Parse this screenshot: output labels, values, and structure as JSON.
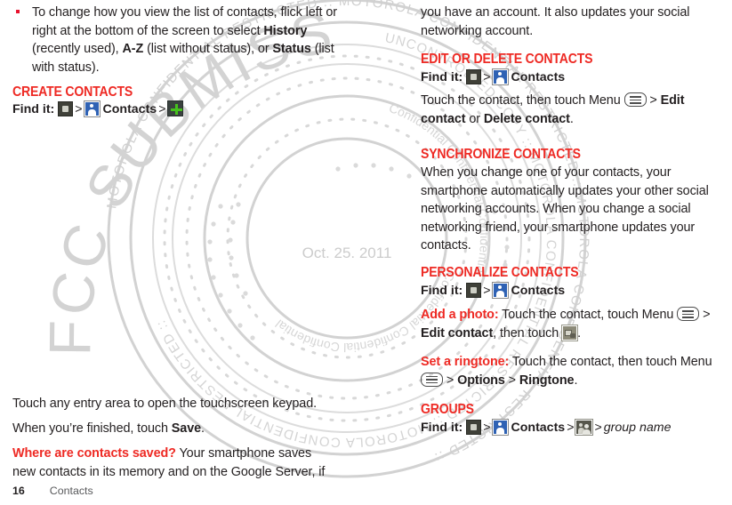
{
  "page": {
    "number": "16",
    "section": "Contacts"
  },
  "watermark": {
    "big_text": "FCC SUBMISSION",
    "ring_outer": "MOTOROLA CONFIDENTIAL RESTRICTED :: MOTOROLA CONFIDENTIAL RESTRICTED :: MOTOROLA CONFIDENTIAL RESTRICTED :: ",
    "ring_inner": "UNCONTROLLED COPY :: MOTOROLA CONFIDENTIAL RESTRICTED :: MOTOROLA CONFIDENTIAL RESTRICTED :: ",
    "ring_small": "Confidential Confidential Confidential ",
    "date": "Oct. 25. 2011",
    "color": "#cfcfcf"
  },
  "left_column": {
    "bullet": {
      "text_1": "To change how you view the list of contacts, flick left or right at the bottom of the screen to select ",
      "bold_1": "History",
      "text_2": " (recently used), ",
      "bold_2": "A-Z",
      "text_3": " (list without status), or ",
      "bold_3": "Status",
      "text_4": " (list with status)."
    },
    "create_contacts": {
      "heading": "CREATE CONTACTS",
      "find_it_label": "Find it:",
      "icon_launcher": "app-launcher-icon",
      "sep": ">",
      "icon_contacts": "contacts-icon",
      "contacts_label": "Contacts",
      "icon_plus": "add-plus-icon"
    },
    "para_touch_entry": "Touch any entry area to open the touchscreen keypad.",
    "para_finished_1": "When you’re finished, touch ",
    "para_finished_bold": "Save",
    "para_finished_2": ".",
    "where_saved": {
      "lead": "Where are contacts saved?",
      "text": " Your smartphone saves new contacts in its memory and on the Google Server, if"
    }
  },
  "right_column": {
    "continued_para": "you have an account. It also updates your social networking account.",
    "edit_or_delete": {
      "heading": "EDIT OR DELETE CONTACTS",
      "find_it_label": "Find it:",
      "icon_launcher": "app-launcher-icon",
      "sep": ">",
      "icon_contacts": "contacts-icon",
      "contacts_label": "Contacts",
      "body_1": "Touch the contact, then touch Menu ",
      "icon_menu": "menu-key-icon",
      "body_2": " > ",
      "bold_1": "Edit contact",
      "body_3": " or ",
      "bold_2": "Delete contact",
      "body_4": "."
    },
    "synchronize": {
      "heading": "SYNCHRONIZE CONTACTS",
      "body": "When you change one of your contacts, your smartphone automatically updates your other social networking accounts. When you change a social networking friend, your smartphone updates your contacts."
    },
    "personalize": {
      "heading": "PERSONALIZE CONTACTS",
      "find_it_label": "Find it:",
      "icon_launcher": "app-launcher-icon",
      "sep": ">",
      "icon_contacts": "contacts-icon",
      "contacts_label": "Contacts",
      "add_photo": {
        "lead": "Add a photo:",
        "text_1": " Touch the contact, touch Menu ",
        "icon_menu": "menu-key-icon",
        "text_2": " > ",
        "bold_1": "Edit contact",
        "text_3": ", then touch ",
        "icon_photo": "photo-icon",
        "text_4": "."
      },
      "set_ringtone": {
        "lead": "Set a ringtone:",
        "text_1": " Touch the contact, then touch Menu ",
        "icon_menu": "menu-key-icon",
        "text_2": " > ",
        "bold_1": "Options",
        "text_3": " > ",
        "bold_2": "Ringtone",
        "text_4": "."
      }
    },
    "groups": {
      "heading": "GROUPS",
      "find_it_label": "Find it:",
      "icon_launcher": "app-launcher-icon",
      "sep": ">",
      "icon_contacts": "contacts-icon",
      "contacts_label": "Contacts",
      "icon_groups": "groups-icon",
      "group_name": "group name"
    }
  }
}
